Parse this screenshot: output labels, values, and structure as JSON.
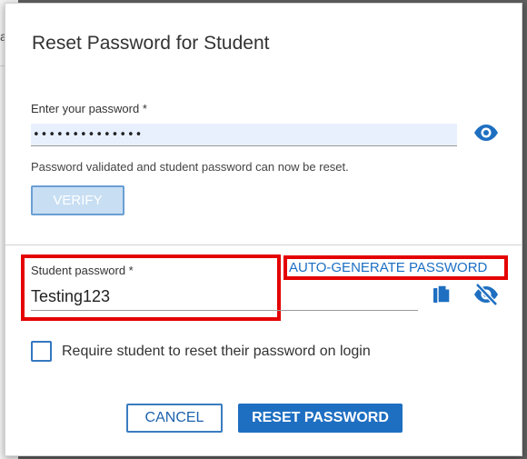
{
  "backdrop": {
    "peek_text": "a"
  },
  "dialog": {
    "title": "Reset Password for Student",
    "enter_password_label": "Enter your password *",
    "enter_password_value": "••••••••••••••",
    "validated_message": "Password validated and student password can now be reset.",
    "verify_label": "VERIFY",
    "student_password_label": "Student password *",
    "student_password_value": "Testing123",
    "auto_generate_label": "AUTO-GENERATE PASSWORD",
    "require_reset_label": "Require student to reset their password on login",
    "cancel_label": "CANCEL",
    "reset_label": "RESET PASSWORD"
  },
  "icons": {
    "show_password": "eye-icon",
    "copy": "copy-icon",
    "hide_password": "eye-slash-icon"
  },
  "colors": {
    "accent": "#1e6fc1",
    "highlight": "#e50000",
    "verify_bg": "#c8def3"
  }
}
